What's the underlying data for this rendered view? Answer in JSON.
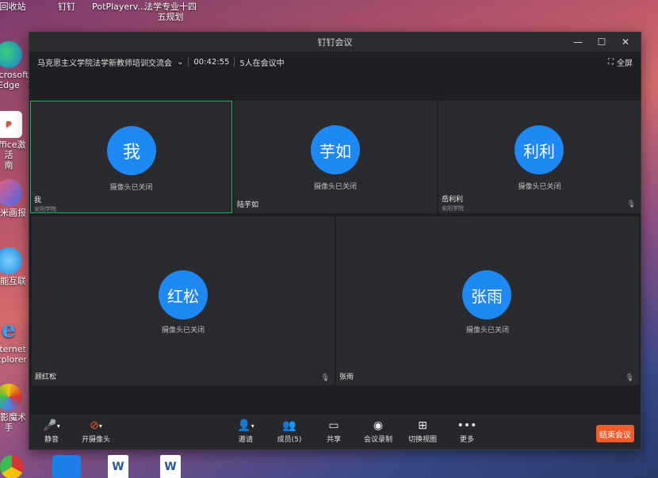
{
  "desktop": {
    "icons": [
      {
        "label": "回收站"
      },
      {
        "label": "钉钉"
      },
      {
        "label": "PotPlayerv..."
      },
      {
        "label": "法学专业十四五规划"
      },
      {
        "label": "Microsoft Edge"
      },
      {
        "label": "Office激活\n南"
      },
      {
        "label": "小米画报"
      },
      {
        "label": "智能互联"
      },
      {
        "label": "Internet Explorer"
      },
      {
        "label": "光影魔术手"
      }
    ]
  },
  "window": {
    "title": "钉钉会议",
    "controls": {
      "minimize": "—",
      "maximize": "☐",
      "close": "✕"
    }
  },
  "infobar": {
    "meeting_name": "马克思主义学院法学新教师培训交流会",
    "duration": "00:42:55",
    "participants_text": "5人在会议中",
    "fullscreen_label": "全屏"
  },
  "participants": [
    {
      "avatar": "我",
      "status": "摄像头已关闭",
      "name": "我",
      "org": "安阳学院"
    },
    {
      "avatar": "芋如",
      "status": "摄像头已关闭",
      "name": "陆芋如",
      "org": ""
    },
    {
      "avatar": "利利",
      "status": "摄像头已关闭",
      "name": "岳利利",
      "org": "安阳学院"
    },
    {
      "avatar": "红松",
      "status": "摄像头已关闭",
      "name": "顾红松",
      "org": ""
    },
    {
      "avatar": "张雨",
      "status": "摄像头已关闭",
      "name": "张雨",
      "org": ""
    }
  ],
  "toolbar": {
    "mute": "静音",
    "camera": "开摄像头",
    "invite": "邀请",
    "members": "成员(5)",
    "share": "共享",
    "record": "会议录制",
    "switch_view": "切换视图",
    "more": "更多",
    "end": "结束会议"
  },
  "colors": {
    "accent": "#1e88f5",
    "active_border": "#1fb25a",
    "end_button": "#f25c2a"
  }
}
